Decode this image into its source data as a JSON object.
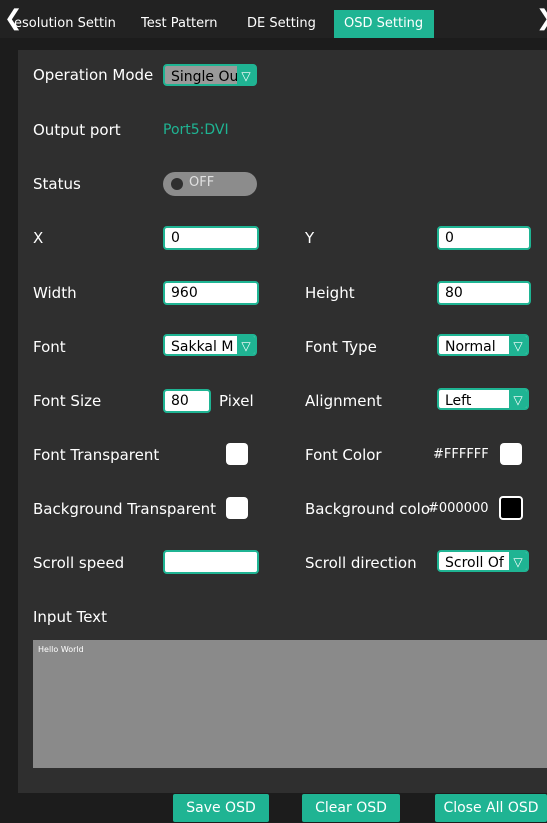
{
  "tabs": [
    {
      "label": "esolution Settin"
    },
    {
      "label": "Test Pattern"
    },
    {
      "label": "DE Setting"
    },
    {
      "label": "OSD Setting"
    }
  ],
  "nav": {
    "back": "❮",
    "forward": "❯"
  },
  "fields": {
    "operation_mode": {
      "label": "Operation Mode",
      "value": "Single Ou"
    },
    "output_port": {
      "label": "Output port",
      "value": "Port5:DVI"
    },
    "status": {
      "label": "Status",
      "value": "OFF"
    },
    "x": {
      "label": "X",
      "value": "0"
    },
    "y": {
      "label": "Y",
      "value": "0"
    },
    "width": {
      "label": "Width",
      "value": "960"
    },
    "height": {
      "label": "Height",
      "value": "80"
    },
    "font": {
      "label": "Font",
      "value": "Sakkal M"
    },
    "font_type": {
      "label": "Font Type",
      "value": "Normal"
    },
    "font_size": {
      "label": "Font Size",
      "value": "80",
      "unit": "Pixel"
    },
    "alignment": {
      "label": "Alignment",
      "value": "Left"
    },
    "font_transparent": {
      "label": "Font Transparent"
    },
    "font_color": {
      "label": "Font Color",
      "value": "#FFFFFF"
    },
    "background_transparent": {
      "label": "Background Transparent"
    },
    "background_color": {
      "label": "Background colo",
      "value": "#000000"
    },
    "scroll_speed": {
      "label": "Scroll speed",
      "value": ""
    },
    "scroll_direction": {
      "label": "Scroll direction",
      "value": "Scroll Of"
    },
    "input_text": {
      "label": "Input Text",
      "value": "Hello World"
    }
  },
  "dropdown_arrow": "▽",
  "buttons": {
    "save": "Save OSD",
    "clear": "Clear OSD",
    "close_all": "Close All OSD"
  },
  "colors": {
    "accent": "#1fb493",
    "background": "#2f2f2f",
    "text_area": "#8a8a8a"
  }
}
